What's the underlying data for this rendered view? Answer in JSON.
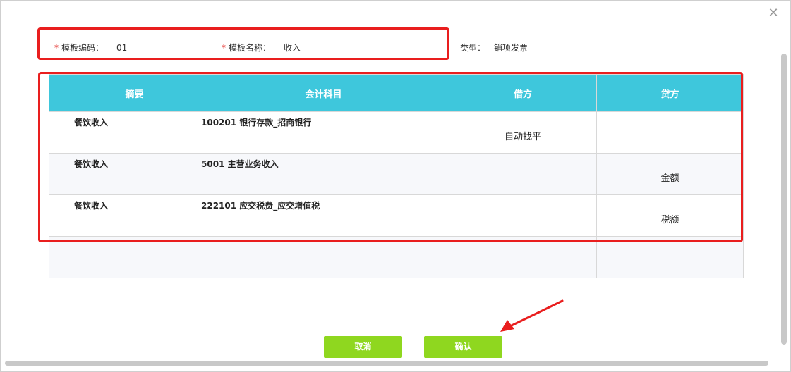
{
  "dialog": {
    "close_glyph": "✕"
  },
  "form": {
    "required_mark": "*",
    "code_label": "模板编码：",
    "code_value": "01",
    "name_label": "模板名称：",
    "name_value": "收入",
    "type_label": "类型：",
    "type_value": "销项发票"
  },
  "table": {
    "headers": [
      "",
      "摘要",
      "会计科目",
      "借方",
      "贷方"
    ],
    "rows": [
      {
        "summary": "餐饮收入",
        "account": "100201 银行存款_招商银行",
        "debit": "自动找平",
        "credit": ""
      },
      {
        "summary": "餐饮收入",
        "account": "5001 主营业务收入",
        "debit": "",
        "credit": "金额"
      },
      {
        "summary": "餐饮收入",
        "account": "222101 应交税费_应交增值税",
        "debit": "",
        "credit": "税额"
      },
      {
        "summary": "",
        "account": "",
        "debit": "",
        "credit": ""
      }
    ]
  },
  "buttons": {
    "cancel": "取消",
    "confirm": "确认"
  },
  "annotation_color": "#e91e1e",
  "accent_color": "#3ec7dc",
  "button_color": "#8fd71f"
}
